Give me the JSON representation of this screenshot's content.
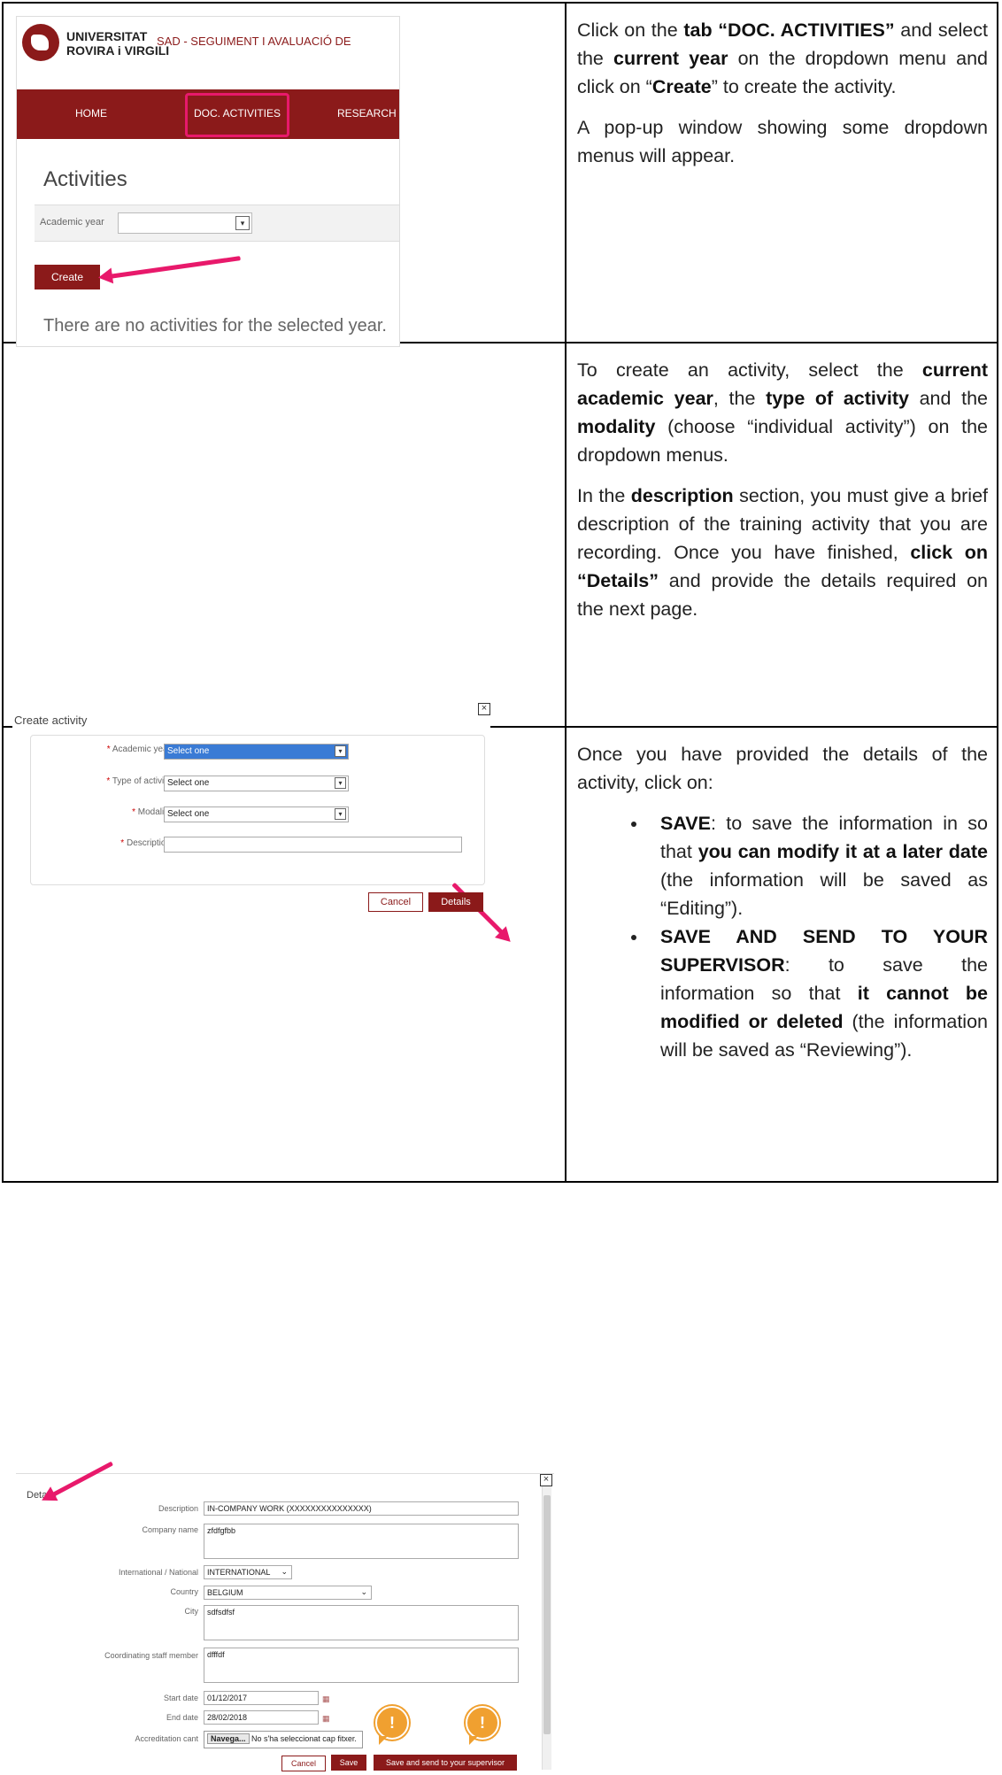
{
  "row1": {
    "screenshot": {
      "uni_line1": "UNIVERSITAT",
      "uni_line2": "ROVIRA i VIRGILI",
      "system_title": "SAD - SEGUIMENT I AVALUACIÓ DE",
      "nav_home": "HOME",
      "nav_doc_activities": "DOC. ACTIVITIES",
      "nav_research": "RESEARCH PL",
      "page_title": "Activities",
      "academic_year_label": "Academic year",
      "create_button": "Create",
      "empty_message": "There are no activities for the selected year."
    },
    "text": {
      "p1_a": "Click on the ",
      "p1_b": "tab “DOC. ACTIVITIES”",
      "p1_c": " and select the ",
      "p1_d": "current year",
      "p1_e": " on the dropdown menu and click on “",
      "p1_f": "Create",
      "p1_g": "” to create the activity.",
      "p2": "A pop-up window showing some dropdown menus will appear."
    }
  },
  "row2": {
    "screenshot": {
      "dialog_title": "Create activity",
      "close_glyph": "×",
      "academic_year_label": "Academic year",
      "type_label": "Type of activity",
      "modality_label": "Modality",
      "description_label": "Description",
      "select_placeholder": "Select one",
      "cancel_button": "Cancel",
      "details_button": "Details",
      "required_mark": "*"
    },
    "text": {
      "p1_a": "To create an activity, select the ",
      "p1_b": "current academic year",
      "p1_c": ", the ",
      "p1_d": "type of activity",
      "p1_e": " and the ",
      "p1_f": "modality",
      "p1_g": " (choose “individual activity”) on the dropdown menus.",
      "p2_a": "In the ",
      "p2_b": "description",
      "p2_c": " section, you must give a brief description of the training activity that you are recording. Once you have finished, ",
      "p2_d": "click on “Details”",
      "p2_e": " and provide the details required on the next page."
    }
  },
  "row3": {
    "screenshot": {
      "section_title": "Details",
      "close_glyph": "×",
      "description_label": "Description",
      "description_value": "IN-COMPANY WORK (XXXXXXXXXXXXXXX)",
      "company_label": "Company name",
      "company_value": "zfdfgfbb",
      "intl_label": "International / National",
      "intl_value": "INTERNATIONAL",
      "country_label": "Country",
      "country_value": "BELGIUM",
      "city_label": "City",
      "city_value": "sdfsdfsf",
      "staff_label": "Coordinating staff member",
      "staff_value": "dfffdf",
      "start_label": "Start date",
      "start_value": "01/12/2017",
      "end_label": "End date",
      "end_value": "28/02/2018",
      "accred_label": "Accreditation cant",
      "browse_button": "Navega...",
      "no_file": "No s'ha seleccionat cap fitxer.",
      "cancel_button": "Cancel",
      "save_button": "Save",
      "save_send_button": "Save and send to your supervisor",
      "alert_glyph": "!"
    },
    "text": {
      "intro": "Once you have provided the details of the activity, click on:",
      "b1_a": "SAVE",
      "b1_b": ": to save the information in so that ",
      "b1_c": "you can modify it at a later date",
      "b1_d": " (the information will be saved as “Editing”).",
      "b2_a": "SAVE AND SEND TO YOUR SUPERVISOR",
      "b2_b": ": to save the information so that ",
      "b2_c": "it cannot be modified or deleted",
      "b2_d": " (the information will be saved as “Reviewing”)."
    }
  }
}
